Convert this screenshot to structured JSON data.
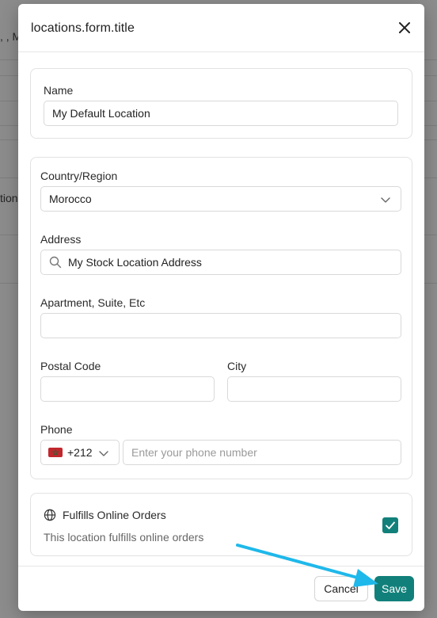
{
  "background": {
    "fragment_top": ", , M",
    "fragment_mid": "tion"
  },
  "modal": {
    "title": "locations.form.title",
    "close_icon": "close-icon"
  },
  "name_section": {
    "label": "Name",
    "value": "My Default Location"
  },
  "address_section": {
    "country_label": "Country/Region",
    "country_value": "Morocco",
    "address_label": "Address",
    "address_value": "My Stock Location Address",
    "apartment_label": "Apartment, Suite, Etc",
    "apartment_value": "",
    "postal_label": "Postal Code",
    "postal_value": "",
    "city_label": "City",
    "city_value": "",
    "phone_label": "Phone",
    "phone_country_code": "+212",
    "phone_placeholder": "Enter your phone number"
  },
  "fulfillment": {
    "title": "Fulfills Online Orders",
    "description": "This location fulfills online orders",
    "checked": true
  },
  "footer": {
    "cancel_label": "Cancel",
    "save_label": "Save"
  },
  "colors": {
    "accent": "#12807a",
    "annotation_arrow": "#1fb8ea"
  }
}
